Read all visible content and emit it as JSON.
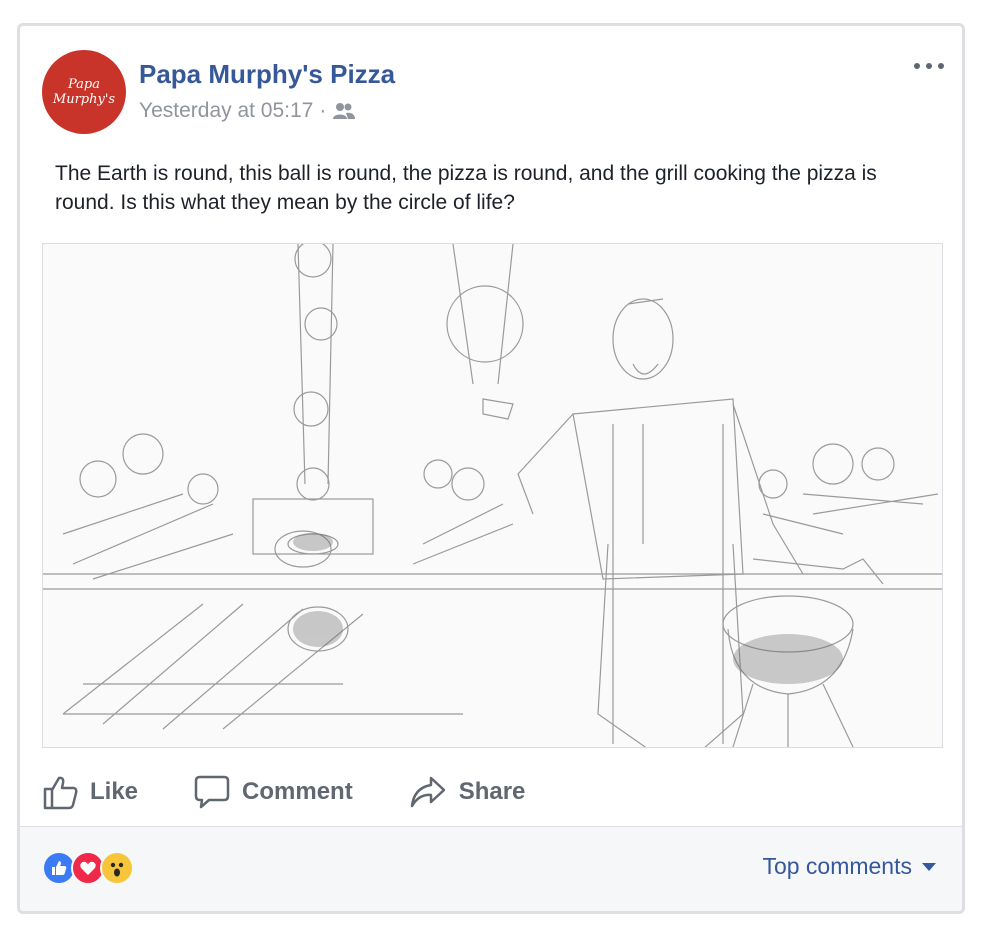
{
  "post": {
    "page_name": "Papa Murphy's Pizza",
    "avatar_text": "Papa\nMurphy's",
    "timestamp": "Yesterday at 05:17",
    "separator": "·",
    "audience_icon": "friends-icon",
    "more_icon": "more-options-icon",
    "text": "The Earth is round, this ball is round, the pizza is round, and the grill cooking the pizza is round. Is this what they mean by the circle of life?",
    "image": {
      "description_icon": "sketch-photo"
    }
  },
  "actions": {
    "like": "Like",
    "comment": "Comment",
    "share": "Share"
  },
  "footer": {
    "reactions": [
      "like",
      "love",
      "wow"
    ],
    "top_comments": "Top comments"
  },
  "colors": {
    "brand_blue": "#365899",
    "meta_gray": "#90949c",
    "action_gray": "#606770",
    "avatar_red": "#c8342a"
  }
}
